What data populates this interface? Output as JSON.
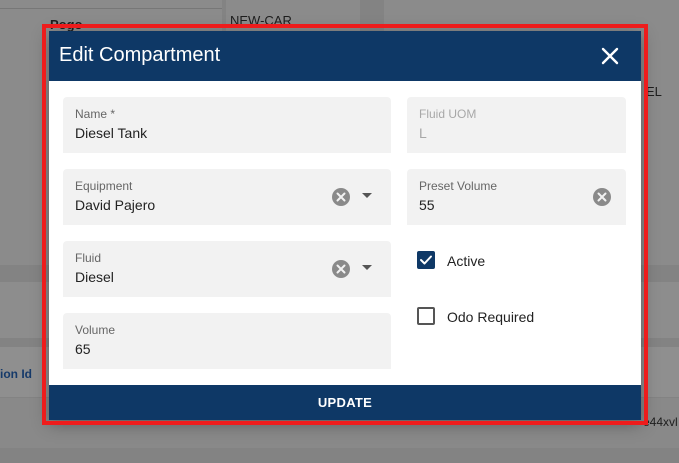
{
  "background": {
    "top_left_label": "Pogo",
    "top_value": "NEW-CAR",
    "right_value_fragment": "EL",
    "column_fragment": "ion Id",
    "row_fragment_right": "e44xvl"
  },
  "dialog": {
    "title": "Edit Compartment",
    "fields": {
      "name": {
        "label": "Name *",
        "value": "Diesel Tank"
      },
      "fluid_uom": {
        "label": "Fluid UOM",
        "value": "L"
      },
      "equipment": {
        "label": "Equipment",
        "value": "David Pajero"
      },
      "preset_volume": {
        "label": "Preset Volume",
        "value": "55"
      },
      "fluid": {
        "label": "Fluid",
        "value": "Diesel"
      },
      "volume": {
        "label": "Volume",
        "value": "65"
      }
    },
    "checkboxes": {
      "active": {
        "label": "Active",
        "checked": true
      },
      "odo_required": {
        "label": "Odo Required",
        "checked": false
      }
    },
    "update_label": "UPDATE"
  },
  "colors": {
    "primary": "#0e3866",
    "highlight": "#ee1c1c"
  }
}
